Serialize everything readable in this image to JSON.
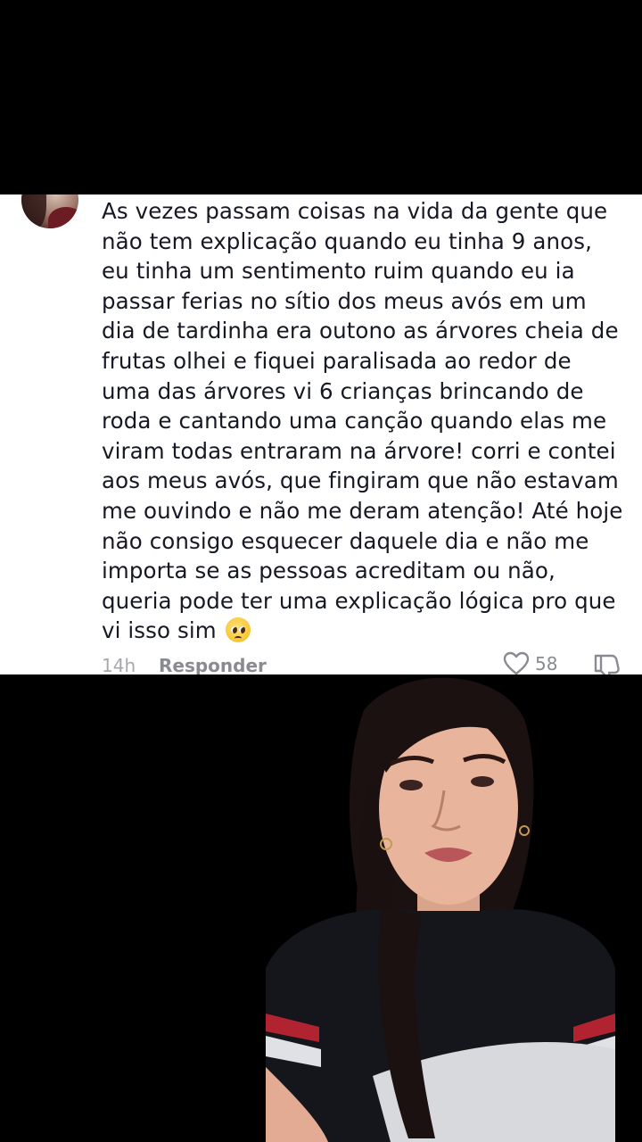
{
  "comment": {
    "text_lines": [
      "As vezes passam coisas na vida da gente que",
      "não tem explicação quando eu tinha 9 anos,",
      "eu tinha um sentimento ruim quando eu ia",
      "passar ferias no sítio dos meus avós em um",
      "dia de tardinha era outono as árvores cheia de",
      "frutas olhei e fiquei paralisada ao redor de",
      "uma das árvores vi 6 crianças brincando de",
      "roda e cantando uma canção quando elas me",
      "viram todas entraram na árvore! corri e contei",
      "aos meus avós, que fingiram que não estavam",
      "me ouvindo e não me deram atenção! Até hoje",
      "não consigo esquecer daquele dia e não me",
      "importa se as pessoas acreditam ou não,",
      "queria pode ter uma explicação lógica pro que",
      "vi isso sim"
    ],
    "emoji": "pleading-face-emoji",
    "time": "14h",
    "reply_label": "Responder",
    "like_count": "58",
    "icons": {
      "like": "heart-outline-icon",
      "dislike": "thumbs-down-icon"
    },
    "colors": {
      "card_bg": "#ffffff",
      "text": "#161823",
      "meta": "#8a8b91"
    }
  }
}
